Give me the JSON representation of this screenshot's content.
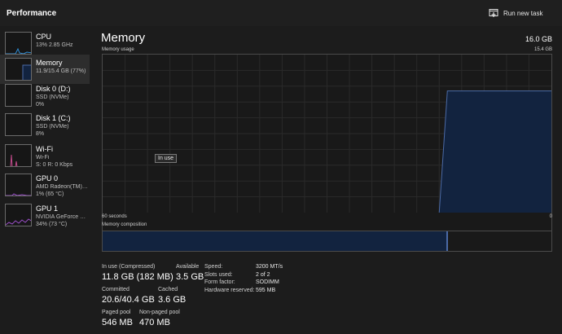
{
  "header": {
    "title": "Performance",
    "run_task_label": "Run new task"
  },
  "sidebar": {
    "items": [
      {
        "name": "CPU",
        "sub": "13%  2.85 GHz",
        "sub2": "",
        "thumb_color": "#2f8fd8",
        "active": false
      },
      {
        "name": "Memory",
        "sub": "11.9/15.4 GB (77%)",
        "sub2": "",
        "thumb_color": "#4b6aa6",
        "active": true
      },
      {
        "name": "Disk 0 (D:)",
        "sub": "SSD (NVMe)",
        "sub2": "0%",
        "thumb_color": "#5a9e3a",
        "active": false
      },
      {
        "name": "Disk 1 (C:)",
        "sub": "SSD (NVMe)",
        "sub2": "8%",
        "thumb_color": "#5a9e3a",
        "active": false
      },
      {
        "name": "Wi-Fi",
        "sub": "Wi-Fi",
        "sub2": "S: 0 R: 0 Kbps",
        "thumb_color": "#c24a8a",
        "active": false
      },
      {
        "name": "GPU 0",
        "sub": "AMD Radeon(TM) Gr...",
        "sub2": "1% (65 °C)",
        "thumb_color": "#9b4fc8",
        "active": false
      },
      {
        "name": "GPU 1",
        "sub": "NVIDIA GeForce RTX...",
        "sub2": "34% (73 °C)",
        "thumb_color": "#9b4fc8",
        "active": false
      }
    ]
  },
  "memory": {
    "title": "Memory",
    "total": "16.0 GB",
    "usage_label": "Memory usage",
    "usage_max": "15.4 GB",
    "time_left": "60 seconds",
    "time_right": "0",
    "tooltip": "In use",
    "composition_label": "Memory composition",
    "composition_in_use_fraction": 0.77,
    "usage_fraction": 0.77,
    "usage_start_fraction": 0.75,
    "accent": "#4b6aa6",
    "fill": "#12233f"
  },
  "stats": {
    "in_use_label": "In use (Compressed)",
    "in_use_value": "11.8 GB (182 MB)",
    "available_label": "Available",
    "available_value": "3.5 GB",
    "committed_label": "Committed",
    "committed_value": "20.6/40.4 GB",
    "cached_label": "Cached",
    "cached_value": "3.6 GB",
    "paged_label": "Paged pool",
    "paged_value": "546 MB",
    "nonpaged_label": "Non-paged pool",
    "nonpaged_value": "470 MB"
  },
  "details": {
    "speed_label": "Speed:",
    "speed_value": "3200 MT/s",
    "slots_label": "Slots used:",
    "slots_value": "2 of 2",
    "form_label": "Form factor:",
    "form_value": "SODIMM",
    "hwres_label": "Hardware reserved:",
    "hwres_value": "595 MB"
  }
}
